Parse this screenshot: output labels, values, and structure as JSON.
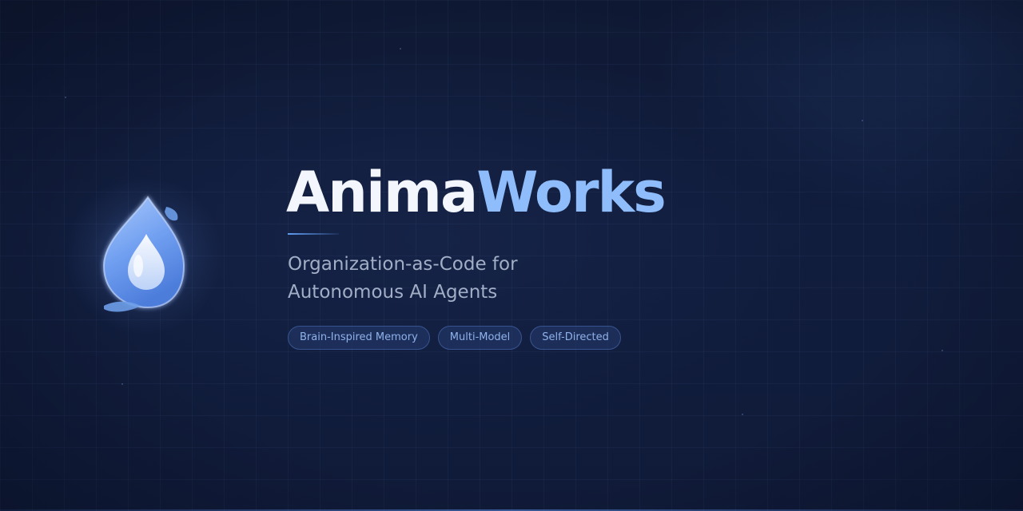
{
  "title": {
    "part1": "Anima",
    "part2": "Works"
  },
  "subtitle": {
    "line1": "Organization-as-Code for",
    "line2": "Autonomous AI Agents"
  },
  "tags": [
    "Brain-Inspired Memory",
    "Multi-Model",
    "Self-Directed"
  ],
  "colors": {
    "background": "#0f1934",
    "title_primary": "#f3f6fc",
    "title_accent": "#8fbdfb",
    "subtitle": "#a2aec6",
    "tag_text": "#8fb2ea",
    "tag_border": "#3d5a93",
    "logo_fill": "#6f9ef0"
  },
  "icons": {
    "logo": "water-droplet-logo-icon"
  }
}
